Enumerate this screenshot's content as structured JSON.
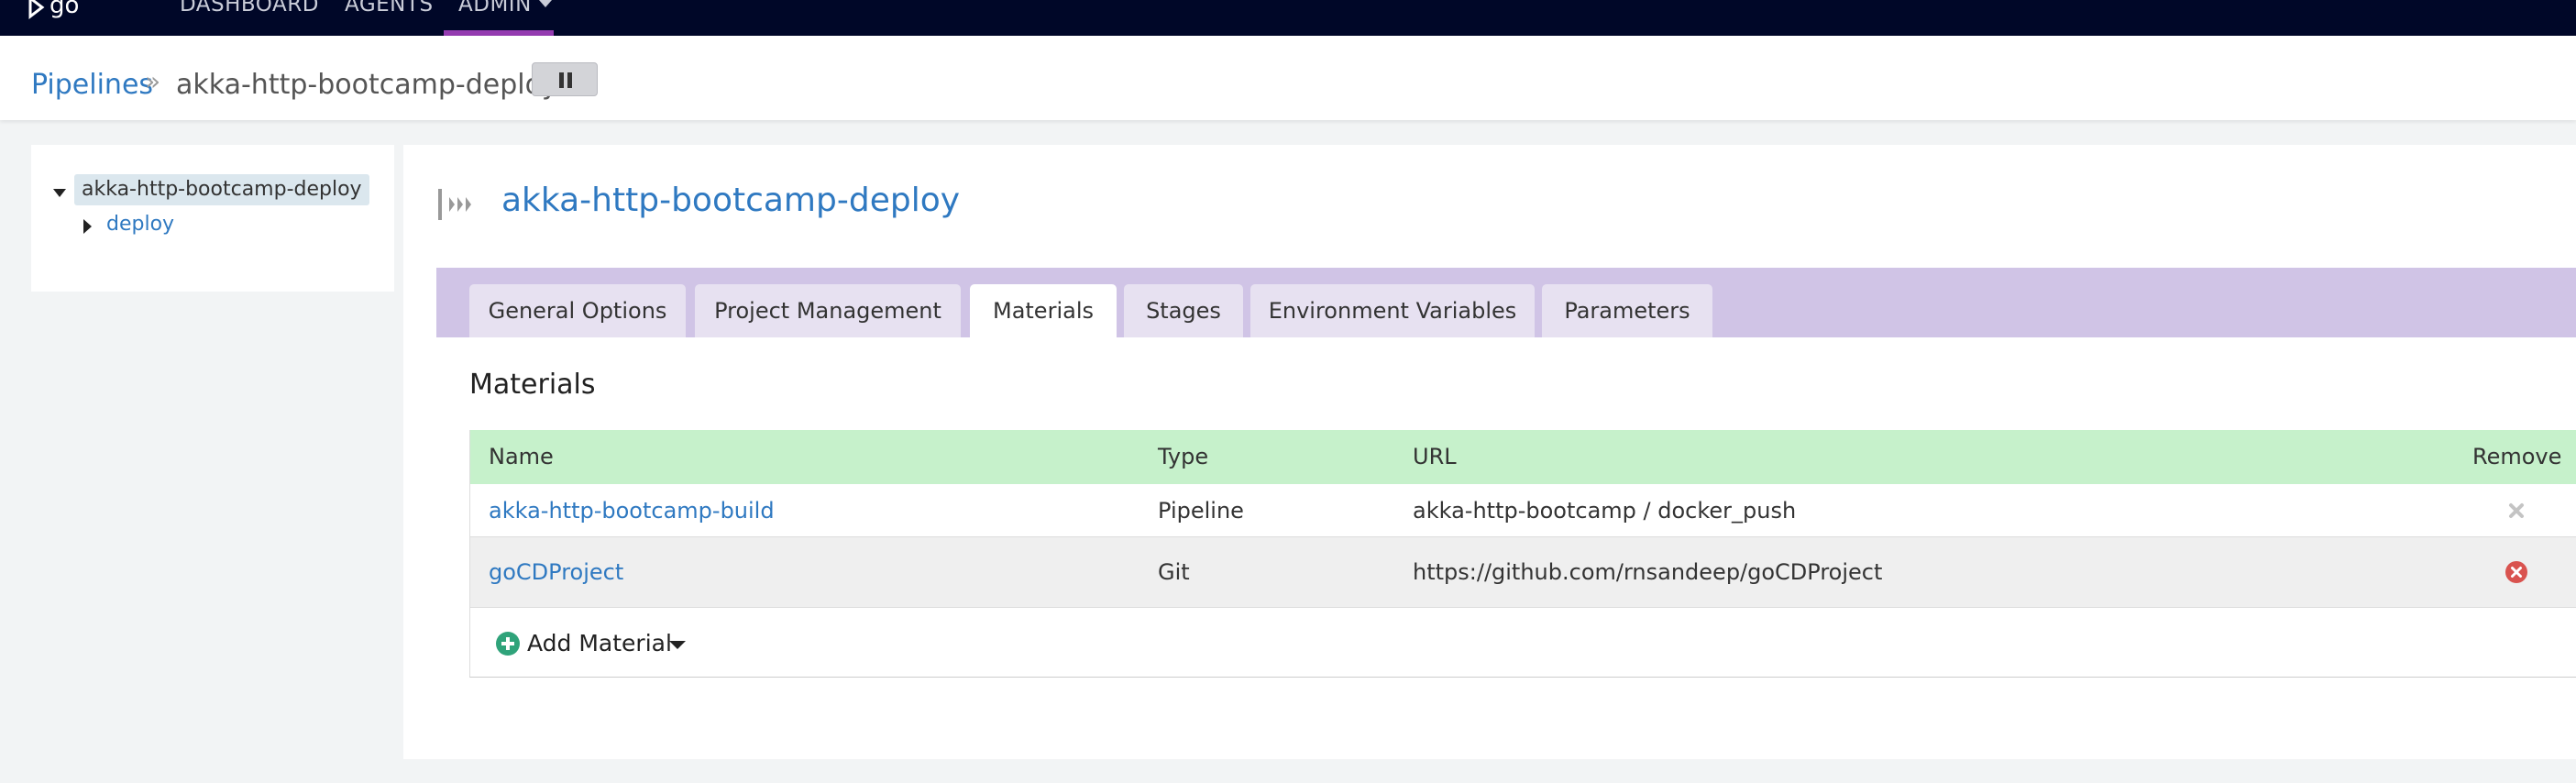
{
  "topnav": {
    "logo_text": "go",
    "items": [
      {
        "label": "DASHBOARD"
      },
      {
        "label": "AGENTS"
      },
      {
        "label": "ADMIN"
      }
    ]
  },
  "breadcrumb": {
    "root": "Pipelines",
    "separator": "»",
    "current": "akka-http-bootcamp-deploy"
  },
  "tree": {
    "root": "akka-http-bootcamp-deploy",
    "children": [
      "deploy"
    ]
  },
  "pipeline": {
    "title": "akka-http-bootcamp-deploy"
  },
  "tabs": [
    {
      "label": "General Options",
      "active": false
    },
    {
      "label": "Project Management",
      "active": false
    },
    {
      "label": "Materials",
      "active": true
    },
    {
      "label": "Stages",
      "active": false
    },
    {
      "label": "Environment Variables",
      "active": false
    },
    {
      "label": "Parameters",
      "active": false
    }
  ],
  "materials": {
    "section_title": "Materials",
    "columns": [
      "Name",
      "Type",
      "URL",
      "Remove"
    ],
    "rows": [
      {
        "name": "akka-http-bootcamp-build",
        "type": "Pipeline",
        "url": "akka-http-bootcamp / docker_push",
        "remove_icon": "remove-disabled-icon"
      },
      {
        "name": "goCDProject",
        "type": "Git",
        "url": "https://github.com/rnsandeep/goCDProject",
        "remove_icon": "remove-enabled-icon"
      }
    ],
    "add_label": "Add Material"
  },
  "colors": {
    "topbar": "#000728",
    "admin_accent": "#943bb0",
    "link": "#2f79c1",
    "tabs_bar": "#d0c4e6",
    "table_header": "#c6f1cb",
    "remove_enabled": "#d9534f",
    "add_icon": "#2fa37a"
  }
}
